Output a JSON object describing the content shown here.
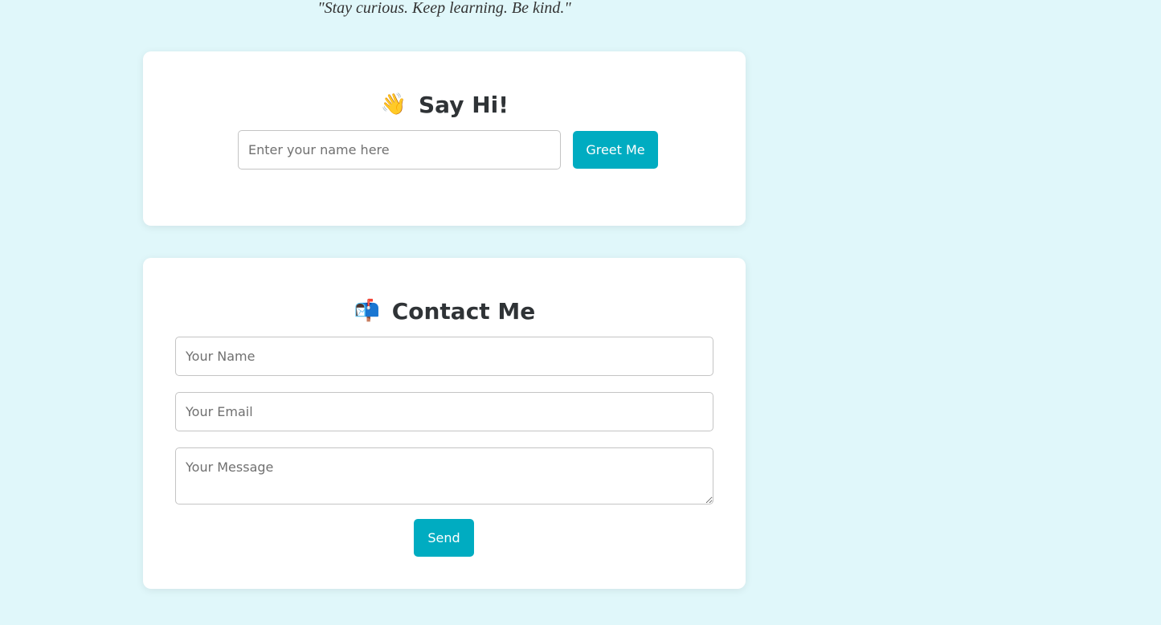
{
  "quote": "\"Stay curious. Keep learning. Be kind.\"",
  "greet_card": {
    "icon": "waving-hand",
    "emoji": "👋",
    "title": "Say Hi!",
    "name_placeholder": "Enter your name here",
    "button_label": "Greet Me"
  },
  "contact_card": {
    "icon": "mailbox",
    "emoji": "📬",
    "title": "Contact Me",
    "name_placeholder": "Your Name",
    "email_placeholder": "Your Email",
    "message_placeholder": "Your Message",
    "button_label": "Send"
  },
  "colors": {
    "background": "#e0f7fa",
    "card": "#ffffff",
    "accent": "#00acc1",
    "heading": "#2f3336"
  }
}
